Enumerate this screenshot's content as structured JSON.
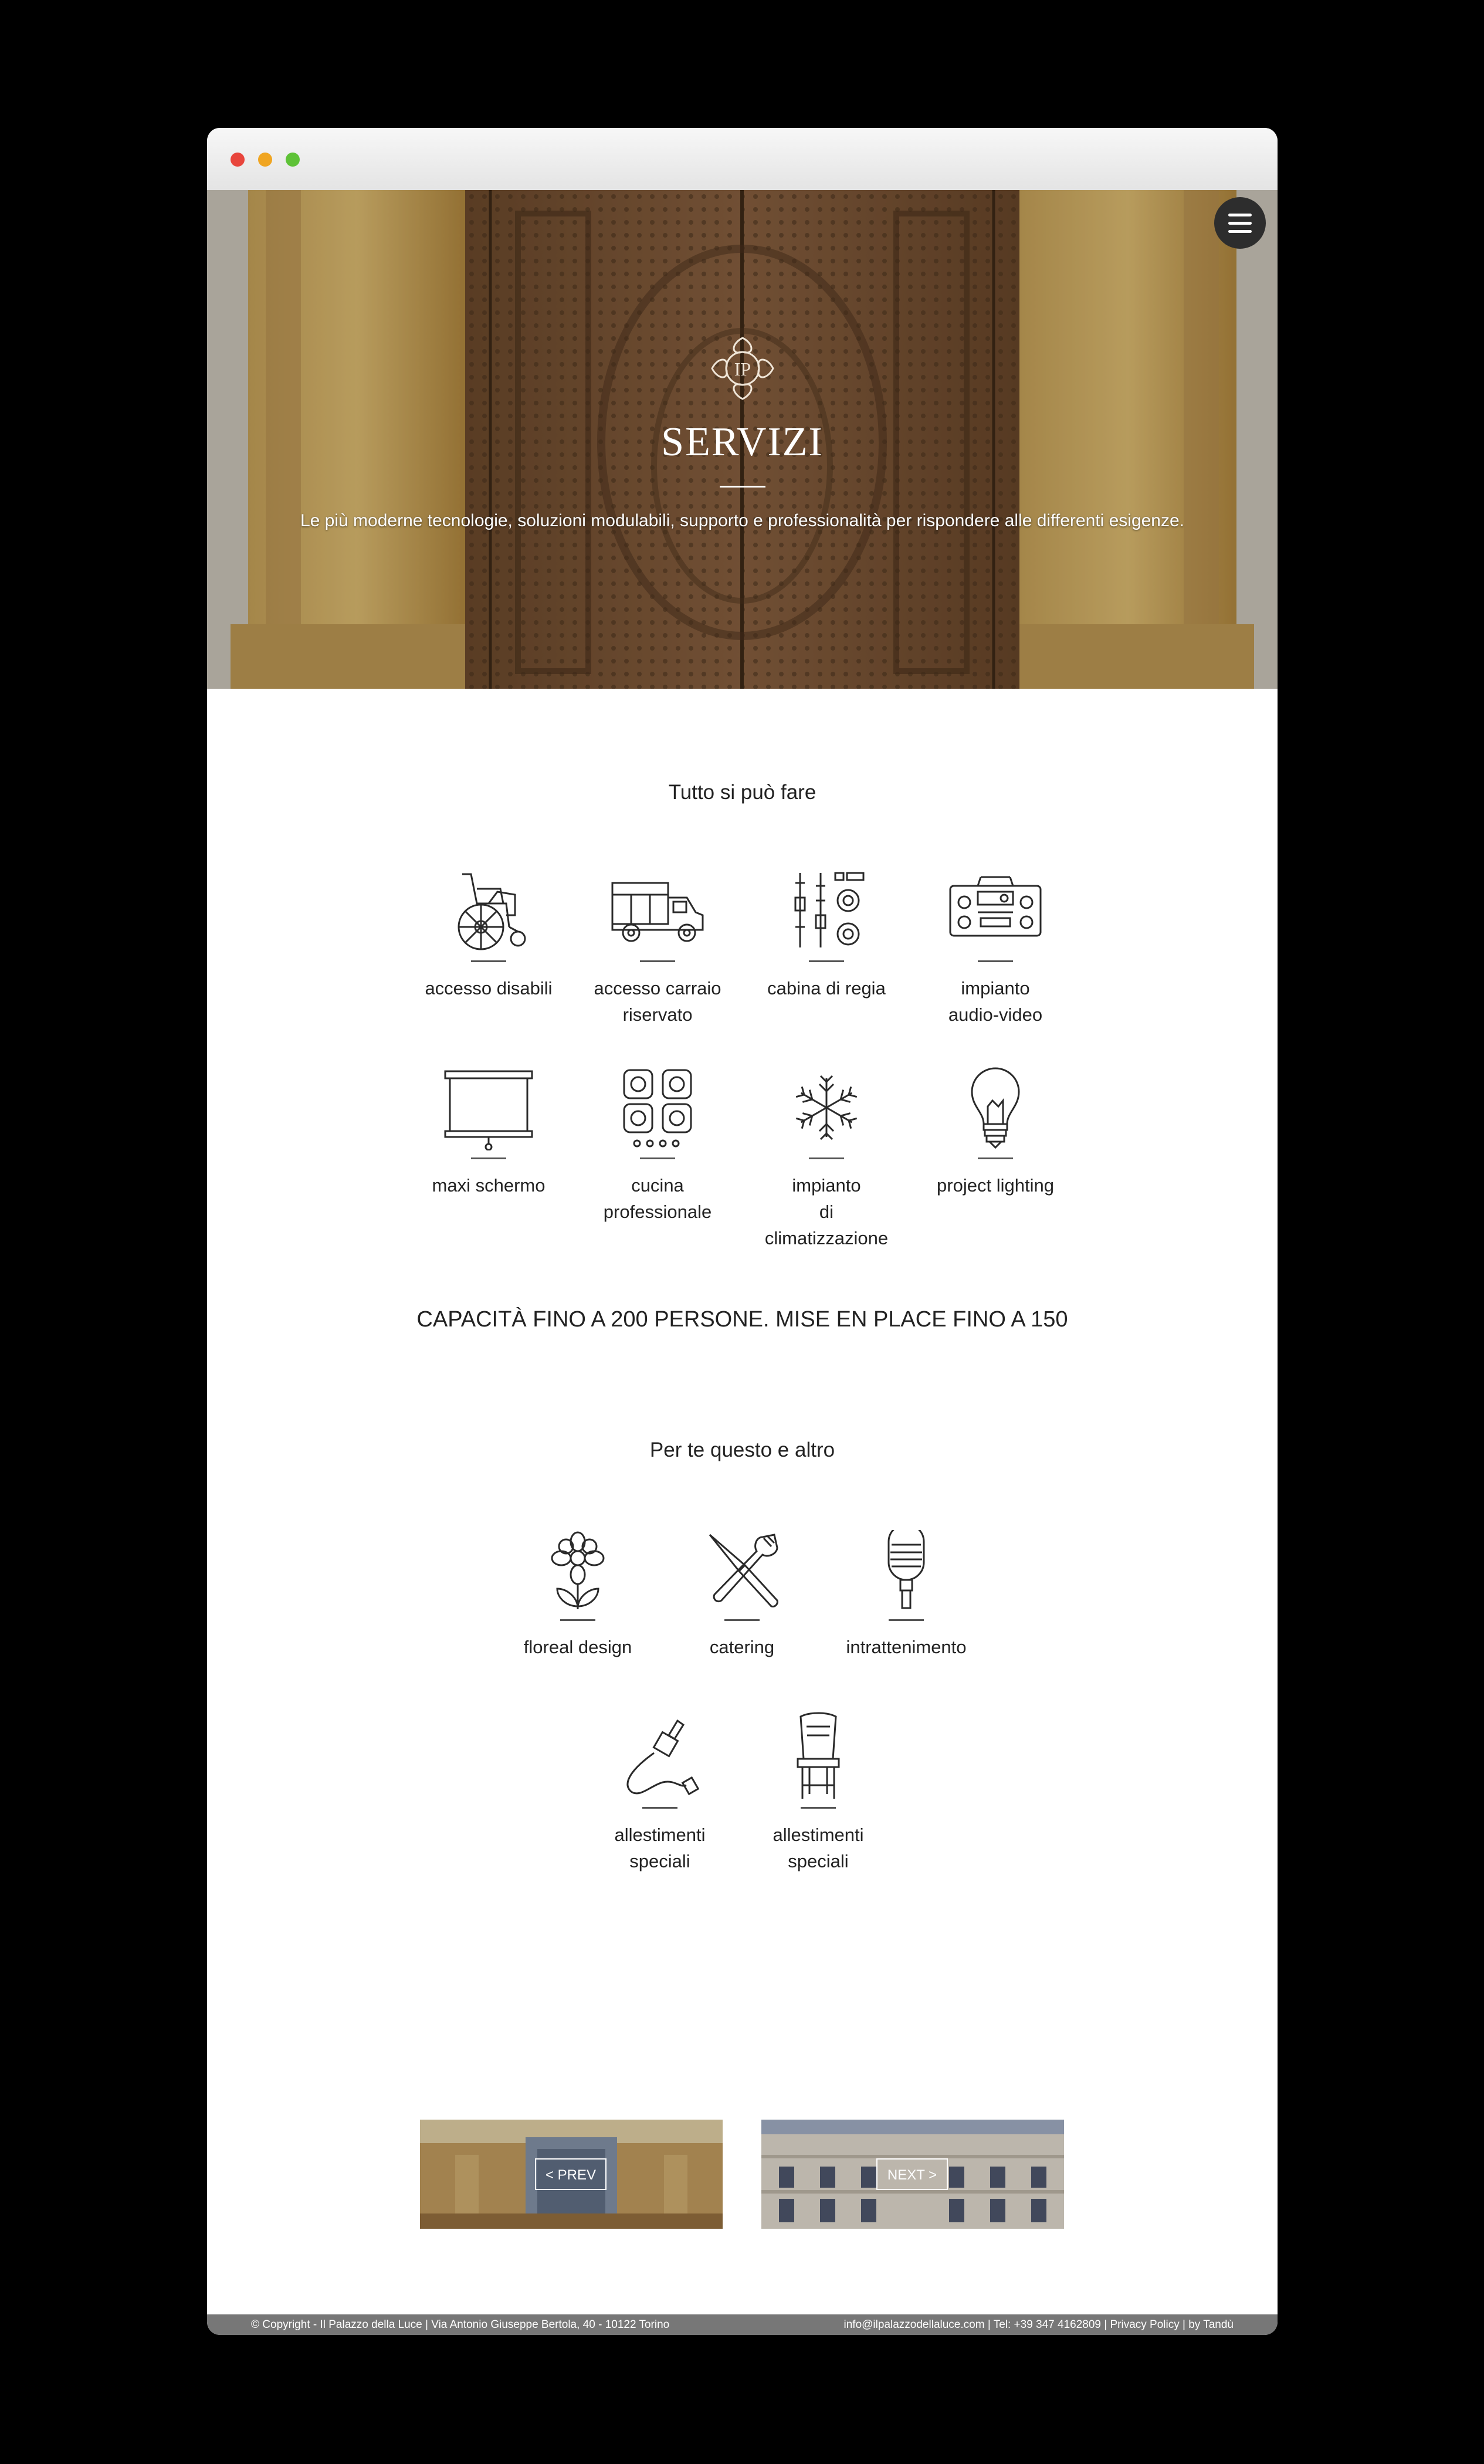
{
  "hero": {
    "title": "SERVIZI",
    "subtitle": "Le più moderne tecnologie, soluzioni modulabili, supporto e professionalità per rispondere alle differenti esigenze.",
    "logo_text": "IP"
  },
  "services": {
    "heading": "Tutto si può fare",
    "items": [
      {
        "label1": "accesso disabili",
        "label2": "",
        "label3": "",
        "icon": "wheelchair-icon"
      },
      {
        "label1": "accesso carraio",
        "label2": "riservato",
        "label3": "",
        "icon": "truck-icon"
      },
      {
        "label1": "cabina di regia",
        "label2": "",
        "label3": "",
        "icon": "mixer-icon"
      },
      {
        "label1": "impianto",
        "label2": "audio-video",
        "label3": "",
        "icon": "stereo-icon"
      },
      {
        "label1": "maxi schermo",
        "label2": "",
        "label3": "",
        "icon": "projector-screen-icon"
      },
      {
        "label1": "cucina",
        "label2": "professionale",
        "label3": "",
        "icon": "stove-icon"
      },
      {
        "label1": "impianto",
        "label2": "di",
        "label3": "climatizzazione",
        "icon": "snowflake-icon"
      },
      {
        "label1": "project lighting",
        "label2": "",
        "label3": "",
        "icon": "lightbulb-icon"
      }
    ]
  },
  "capacity": "CAPACITÀ FINO A 200 PERSONE. MISE EN PLACE FINO A 150",
  "extras": {
    "heading": "Per te questo e altro",
    "items": [
      {
        "label1": "floreal design",
        "label2": "",
        "icon": "flower-icon"
      },
      {
        "label1": "catering",
        "label2": "",
        "icon": "knife-fork-icon"
      },
      {
        "label1": "intrattenimento",
        "label2": "",
        "icon": "microphone-icon"
      },
      {
        "label1": "allestimenti",
        "label2": "speciali",
        "icon": "audio-cable-icon"
      },
      {
        "label1": "allestimenti",
        "label2": "speciali",
        "icon": "chair-icon"
      }
    ]
  },
  "pager": {
    "prev": "< PREV",
    "next": "NEXT >"
  },
  "footer": {
    "left": "© Copyright - Il Palazzo della Luce | Via Antonio Giuseppe Bertola, 40 - 10122 Torino",
    "right": "info@ilpalazzodellaluce.com | Tel: +39 347 4162809 | Privacy Policy | by Tandù"
  }
}
